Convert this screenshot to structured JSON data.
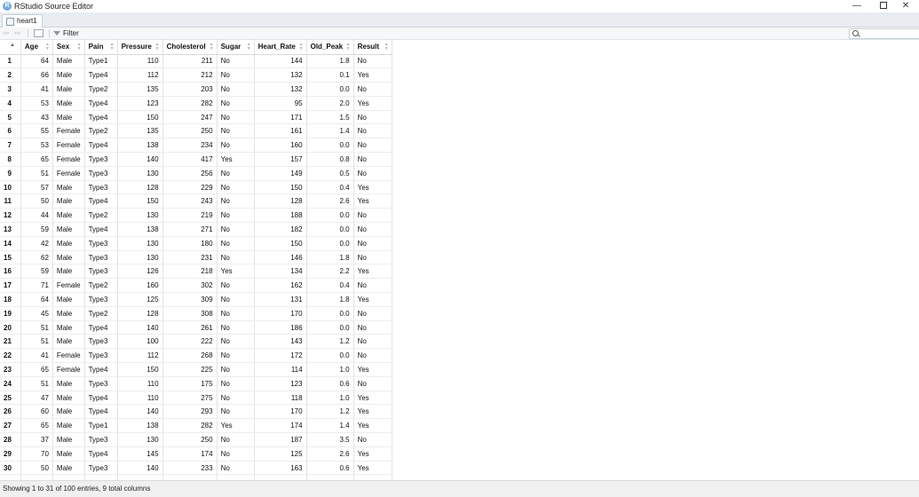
{
  "window": {
    "title": "RStudio Source Editor",
    "logo_letter": "R",
    "minimize": "—",
    "close": "✕"
  },
  "tab": {
    "label": "heart1"
  },
  "toolbar": {
    "back": "⇦",
    "forward": "⇨",
    "filter_label": "Filter",
    "search_placeholder": ""
  },
  "table": {
    "columns": [
      "Age",
      "Sex",
      "Pain",
      "Pressure",
      "Cholesterol",
      "Sugar",
      "Heart_Rate",
      "Old_Peak",
      "Result"
    ],
    "rows": [
      [
        "1",
        "64",
        "Male",
        "Type1",
        "110",
        "211",
        "No",
        "144",
        "1.8",
        "No"
      ],
      [
        "2",
        "66",
        "Male",
        "Type4",
        "112",
        "212",
        "No",
        "132",
        "0.1",
        "Yes"
      ],
      [
        "3",
        "41",
        "Male",
        "Type2",
        "135",
        "203",
        "No",
        "132",
        "0.0",
        "No"
      ],
      [
        "4",
        "53",
        "Male",
        "Type4",
        "123",
        "282",
        "No",
        "95",
        "2.0",
        "Yes"
      ],
      [
        "5",
        "43",
        "Male",
        "Type4",
        "150",
        "247",
        "No",
        "171",
        "1.5",
        "No"
      ],
      [
        "6",
        "55",
        "Female",
        "Type2",
        "135",
        "250",
        "No",
        "161",
        "1.4",
        "No"
      ],
      [
        "7",
        "53",
        "Female",
        "Type4",
        "138",
        "234",
        "No",
        "160",
        "0.0",
        "No"
      ],
      [
        "8",
        "65",
        "Female",
        "Type3",
        "140",
        "417",
        "Yes",
        "157",
        "0.8",
        "No"
      ],
      [
        "9",
        "51",
        "Female",
        "Type3",
        "130",
        "256",
        "No",
        "149",
        "0.5",
        "No"
      ],
      [
        "10",
        "57",
        "Male",
        "Type3",
        "128",
        "229",
        "No",
        "150",
        "0.4",
        "Yes"
      ],
      [
        "11",
        "50",
        "Male",
        "Type4",
        "150",
        "243",
        "No",
        "128",
        "2.6",
        "Yes"
      ],
      [
        "12",
        "44",
        "Male",
        "Type2",
        "130",
        "219",
        "No",
        "188",
        "0.0",
        "No"
      ],
      [
        "13",
        "59",
        "Male",
        "Type4",
        "138",
        "271",
        "No",
        "182",
        "0.0",
        "No"
      ],
      [
        "14",
        "42",
        "Male",
        "Type3",
        "130",
        "180",
        "No",
        "150",
        "0.0",
        "No"
      ],
      [
        "15",
        "62",
        "Male",
        "Type3",
        "130",
        "231",
        "No",
        "146",
        "1.8",
        "No"
      ],
      [
        "16",
        "59",
        "Male",
        "Type3",
        "126",
        "218",
        "Yes",
        "134",
        "2.2",
        "Yes"
      ],
      [
        "17",
        "71",
        "Female",
        "Type2",
        "160",
        "302",
        "No",
        "162",
        "0.4",
        "No"
      ],
      [
        "18",
        "64",
        "Male",
        "Type3",
        "125",
        "309",
        "No",
        "131",
        "1.8",
        "Yes"
      ],
      [
        "19",
        "45",
        "Male",
        "Type2",
        "128",
        "308",
        "No",
        "170",
        "0.0",
        "No"
      ],
      [
        "20",
        "51",
        "Male",
        "Type4",
        "140",
        "261",
        "No",
        "186",
        "0.0",
        "No"
      ],
      [
        "21",
        "51",
        "Male",
        "Type3",
        "100",
        "222",
        "No",
        "143",
        "1.2",
        "No"
      ],
      [
        "22",
        "41",
        "Female",
        "Type3",
        "112",
        "268",
        "No",
        "172",
        "0.0",
        "No"
      ],
      [
        "23",
        "65",
        "Female",
        "Type4",
        "150",
        "225",
        "No",
        "114",
        "1.0",
        "Yes"
      ],
      [
        "24",
        "51",
        "Male",
        "Type3",
        "110",
        "175",
        "No",
        "123",
        "0.6",
        "No"
      ],
      [
        "25",
        "47",
        "Male",
        "Type4",
        "110",
        "275",
        "No",
        "118",
        "1.0",
        "Yes"
      ],
      [
        "26",
        "60",
        "Male",
        "Type4",
        "140",
        "293",
        "No",
        "170",
        "1.2",
        "Yes"
      ],
      [
        "27",
        "65",
        "Male",
        "Type1",
        "138",
        "282",
        "Yes",
        "174",
        "1.4",
        "Yes"
      ],
      [
        "28",
        "37",
        "Male",
        "Type3",
        "130",
        "250",
        "No",
        "187",
        "3.5",
        "No"
      ],
      [
        "29",
        "70",
        "Male",
        "Type4",
        "145",
        "174",
        "No",
        "125",
        "2.6",
        "Yes"
      ],
      [
        "30",
        "50",
        "Male",
        "Type3",
        "140",
        "233",
        "No",
        "163",
        "0.6",
        "Yes"
      ]
    ]
  },
  "status": {
    "text": "Showing 1 to 31 of 100 entries, 9 total columns"
  }
}
